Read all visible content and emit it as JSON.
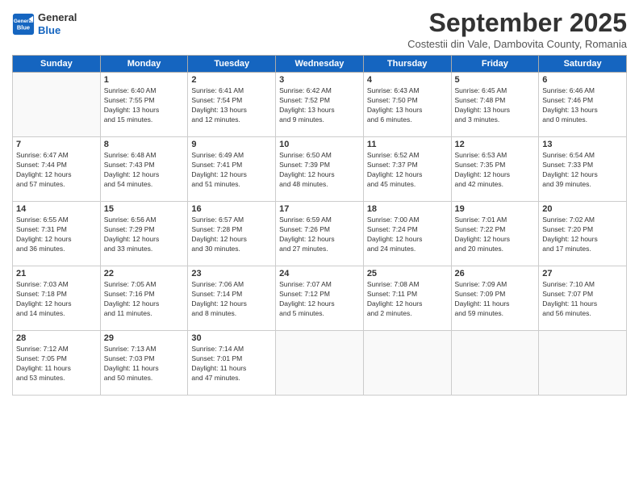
{
  "logo": {
    "line1": "General",
    "line2": "Blue"
  },
  "title": "September 2025",
  "subtitle": "Costestii din Vale, Dambovita County, Romania",
  "headers": [
    "Sunday",
    "Monday",
    "Tuesday",
    "Wednesday",
    "Thursday",
    "Friday",
    "Saturday"
  ],
  "weeks": [
    [
      {
        "day": "",
        "info": []
      },
      {
        "day": "1",
        "info": [
          "Sunrise: 6:40 AM",
          "Sunset: 7:55 PM",
          "Daylight: 13 hours",
          "and 15 minutes."
        ]
      },
      {
        "day": "2",
        "info": [
          "Sunrise: 6:41 AM",
          "Sunset: 7:54 PM",
          "Daylight: 13 hours",
          "and 12 minutes."
        ]
      },
      {
        "day": "3",
        "info": [
          "Sunrise: 6:42 AM",
          "Sunset: 7:52 PM",
          "Daylight: 13 hours",
          "and 9 minutes."
        ]
      },
      {
        "day": "4",
        "info": [
          "Sunrise: 6:43 AM",
          "Sunset: 7:50 PM",
          "Daylight: 13 hours",
          "and 6 minutes."
        ]
      },
      {
        "day": "5",
        "info": [
          "Sunrise: 6:45 AM",
          "Sunset: 7:48 PM",
          "Daylight: 13 hours",
          "and 3 minutes."
        ]
      },
      {
        "day": "6",
        "info": [
          "Sunrise: 6:46 AM",
          "Sunset: 7:46 PM",
          "Daylight: 13 hours",
          "and 0 minutes."
        ]
      }
    ],
    [
      {
        "day": "7",
        "info": [
          "Sunrise: 6:47 AM",
          "Sunset: 7:44 PM",
          "Daylight: 12 hours",
          "and 57 minutes."
        ]
      },
      {
        "day": "8",
        "info": [
          "Sunrise: 6:48 AM",
          "Sunset: 7:43 PM",
          "Daylight: 12 hours",
          "and 54 minutes."
        ]
      },
      {
        "day": "9",
        "info": [
          "Sunrise: 6:49 AM",
          "Sunset: 7:41 PM",
          "Daylight: 12 hours",
          "and 51 minutes."
        ]
      },
      {
        "day": "10",
        "info": [
          "Sunrise: 6:50 AM",
          "Sunset: 7:39 PM",
          "Daylight: 12 hours",
          "and 48 minutes."
        ]
      },
      {
        "day": "11",
        "info": [
          "Sunrise: 6:52 AM",
          "Sunset: 7:37 PM",
          "Daylight: 12 hours",
          "and 45 minutes."
        ]
      },
      {
        "day": "12",
        "info": [
          "Sunrise: 6:53 AM",
          "Sunset: 7:35 PM",
          "Daylight: 12 hours",
          "and 42 minutes."
        ]
      },
      {
        "day": "13",
        "info": [
          "Sunrise: 6:54 AM",
          "Sunset: 7:33 PM",
          "Daylight: 12 hours",
          "and 39 minutes."
        ]
      }
    ],
    [
      {
        "day": "14",
        "info": [
          "Sunrise: 6:55 AM",
          "Sunset: 7:31 PM",
          "Daylight: 12 hours",
          "and 36 minutes."
        ]
      },
      {
        "day": "15",
        "info": [
          "Sunrise: 6:56 AM",
          "Sunset: 7:29 PM",
          "Daylight: 12 hours",
          "and 33 minutes."
        ]
      },
      {
        "day": "16",
        "info": [
          "Sunrise: 6:57 AM",
          "Sunset: 7:28 PM",
          "Daylight: 12 hours",
          "and 30 minutes."
        ]
      },
      {
        "day": "17",
        "info": [
          "Sunrise: 6:59 AM",
          "Sunset: 7:26 PM",
          "Daylight: 12 hours",
          "and 27 minutes."
        ]
      },
      {
        "day": "18",
        "info": [
          "Sunrise: 7:00 AM",
          "Sunset: 7:24 PM",
          "Daylight: 12 hours",
          "and 24 minutes."
        ]
      },
      {
        "day": "19",
        "info": [
          "Sunrise: 7:01 AM",
          "Sunset: 7:22 PM",
          "Daylight: 12 hours",
          "and 20 minutes."
        ]
      },
      {
        "day": "20",
        "info": [
          "Sunrise: 7:02 AM",
          "Sunset: 7:20 PM",
          "Daylight: 12 hours",
          "and 17 minutes."
        ]
      }
    ],
    [
      {
        "day": "21",
        "info": [
          "Sunrise: 7:03 AM",
          "Sunset: 7:18 PM",
          "Daylight: 12 hours",
          "and 14 minutes."
        ]
      },
      {
        "day": "22",
        "info": [
          "Sunrise: 7:05 AM",
          "Sunset: 7:16 PM",
          "Daylight: 12 hours",
          "and 11 minutes."
        ]
      },
      {
        "day": "23",
        "info": [
          "Sunrise: 7:06 AM",
          "Sunset: 7:14 PM",
          "Daylight: 12 hours",
          "and 8 minutes."
        ]
      },
      {
        "day": "24",
        "info": [
          "Sunrise: 7:07 AM",
          "Sunset: 7:12 PM",
          "Daylight: 12 hours",
          "and 5 minutes."
        ]
      },
      {
        "day": "25",
        "info": [
          "Sunrise: 7:08 AM",
          "Sunset: 7:11 PM",
          "Daylight: 12 hours",
          "and 2 minutes."
        ]
      },
      {
        "day": "26",
        "info": [
          "Sunrise: 7:09 AM",
          "Sunset: 7:09 PM",
          "Daylight: 11 hours",
          "and 59 minutes."
        ]
      },
      {
        "day": "27",
        "info": [
          "Sunrise: 7:10 AM",
          "Sunset: 7:07 PM",
          "Daylight: 11 hours",
          "and 56 minutes."
        ]
      }
    ],
    [
      {
        "day": "28",
        "info": [
          "Sunrise: 7:12 AM",
          "Sunset: 7:05 PM",
          "Daylight: 11 hours",
          "and 53 minutes."
        ]
      },
      {
        "day": "29",
        "info": [
          "Sunrise: 7:13 AM",
          "Sunset: 7:03 PM",
          "Daylight: 11 hours",
          "and 50 minutes."
        ]
      },
      {
        "day": "30",
        "info": [
          "Sunrise: 7:14 AM",
          "Sunset: 7:01 PM",
          "Daylight: 11 hours",
          "and 47 minutes."
        ]
      },
      {
        "day": "",
        "info": []
      },
      {
        "day": "",
        "info": []
      },
      {
        "day": "",
        "info": []
      },
      {
        "day": "",
        "info": []
      }
    ]
  ]
}
